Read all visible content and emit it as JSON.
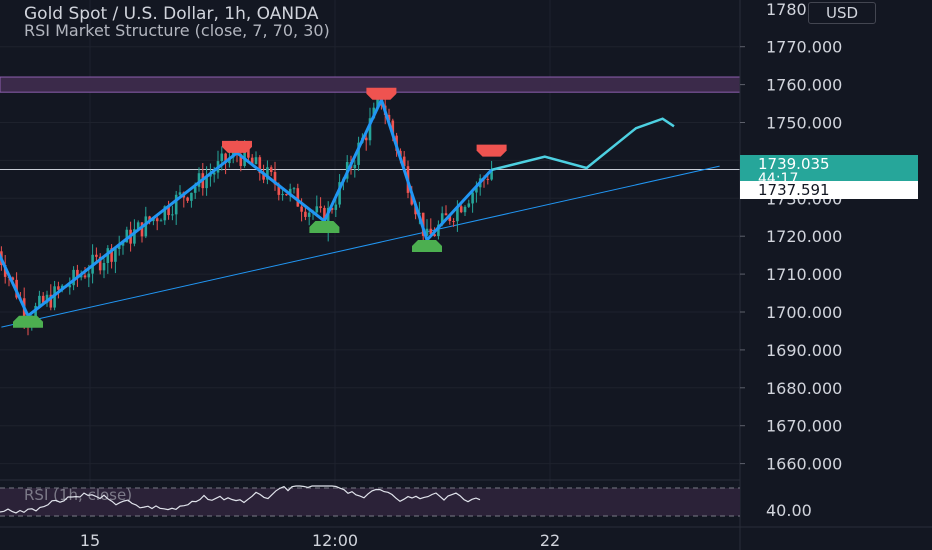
{
  "header": {
    "title": "Gold Spot / U.S. Dollar, 1h, OANDA",
    "subtitle": "RSI Market Structure (close, 7, 70, 30)",
    "currency_button": "USD"
  },
  "price_badge": {
    "value": "1739.035",
    "countdown": "44:17"
  },
  "last_badge": {
    "value": "1737.591"
  },
  "rsi_pane": {
    "label": "RSI (1h, close)",
    "axis_label": "40.00"
  },
  "colors": {
    "background": "#131722",
    "bull": "#26a69a",
    "bear": "#ef5350",
    "zigzag": "#2196f3",
    "forecast": "#4dd0e1",
    "zone": "#5c3a6e",
    "swing_high_marker": "#ef5350",
    "swing_low_marker": "#4caf50"
  },
  "chart_data": {
    "type": "line",
    "title": "Gold Spot / U.S. Dollar, 1h, OANDA",
    "y_axis": {
      "ticks": [
        1660,
        1670,
        1680,
        1690,
        1700,
        1710,
        1720,
        1730,
        1740,
        1750,
        1760,
        1770
      ],
      "top_partial_tick": "1780.000"
    },
    "x_axis": {
      "ticks": [
        "15",
        "12:00",
        "22"
      ]
    },
    "ylim": [
      1656,
      1782
    ],
    "grid": true,
    "resistance_zone": [
      1758,
      1762
    ],
    "current_price": 1739.035,
    "last_price": 1737.591,
    "zigzag": [
      {
        "i": -15,
        "y": 1731
      },
      {
        "i": 0,
        "y": 1699
      },
      {
        "i": 55,
        "y": 1742
      },
      {
        "i": 78,
        "y": 1724
      },
      {
        "i": 93,
        "y": 1756
      },
      {
        "i": 105,
        "y": 1719
      },
      {
        "i": 122,
        "y": 1737.5
      }
    ],
    "swing_markers": [
      {
        "i": 0,
        "y": 1699,
        "kind": "low"
      },
      {
        "i": 55,
        "y": 1742,
        "kind": "high"
      },
      {
        "i": 78,
        "y": 1724,
        "kind": "low"
      },
      {
        "i": 93,
        "y": 1756,
        "kind": "high"
      },
      {
        "i": 105,
        "y": 1719,
        "kind": "low"
      },
      {
        "i": 122,
        "y": 1741,
        "kind": "high"
      }
    ],
    "forecast": [
      {
        "i": 122,
        "y": 1737.5
      },
      {
        "i": 136,
        "y": 1741
      },
      {
        "i": 147,
        "y": 1738
      },
      {
        "i": 160,
        "y": 1748.5
      },
      {
        "i": 167,
        "y": 1751
      },
      {
        "i": 170,
        "y": 1749
      }
    ],
    "trendline": [
      {
        "i": -7,
        "y": 1696
      },
      {
        "i": 182,
        "y": 1738.5
      }
    ],
    "rsi": {
      "ylim": [
        0,
        100
      ],
      "upper": 70,
      "lower": 30
    }
  }
}
